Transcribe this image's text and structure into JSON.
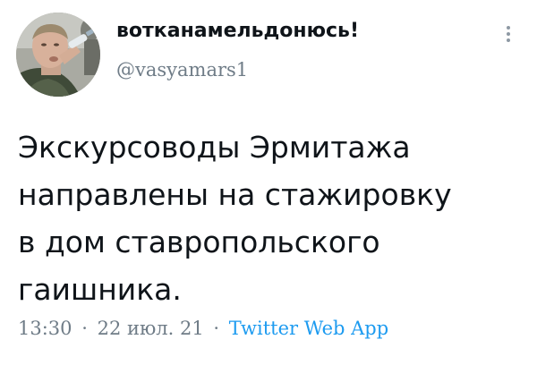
{
  "tweet": {
    "author": {
      "display_name": "вотканамельдонюсь!",
      "handle": "@vasyamars1"
    },
    "text_lines": [
      "Экскурсоводы Эрмитажа",
      "направлены на стажировку",
      "в дом ставропольского",
      "гаишника."
    ],
    "meta": {
      "time": "13:30",
      "separator": "·",
      "date": "22 июл. 21",
      "source": "Twitter Web App"
    },
    "icons": {
      "more": "more-vertical-icon",
      "avatar": "avatar-photo"
    },
    "colors": {
      "text": "#0f1419",
      "secondary": "#6f7c87",
      "link": "#1d9bf0"
    }
  }
}
